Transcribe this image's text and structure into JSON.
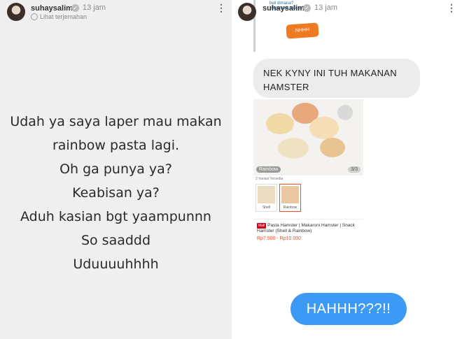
{
  "left_story": {
    "username": "suhaysalim",
    "time": "13 jam",
    "translate_label": "Lihat terjemahan",
    "lines": [
      "Udah ya saya laper mau makan",
      "rainbow pasta lagi.",
      "Oh ga punya ya?",
      "Keabisan ya?",
      "Aduh kasian bgt yaampunnn",
      "So saaddd",
      "Uduuuuhhhh"
    ]
  },
  "right_story": {
    "username": "suhaysalim",
    "time": "13 jam",
    "quoted_text": "beli dimana? Hagemaik beli ya? ...",
    "sticker_text": "NHHH",
    "message_grey": "NEK KYNY INI TUH MAKANAN HAMSTER",
    "product": {
      "image_badge": "Rainbow",
      "image_counter": "3/3",
      "variations_title": "2 Variasi Tersedia",
      "variations": [
        "Shell",
        "Rainbow"
      ],
      "mall_tag": "Mall",
      "title": "Pasta Hamster | Makaroni Hamster | Snack Hamster (Shell & Rainbow)",
      "price": "Rp7.500 - Rp10.000"
    },
    "message_blue": "HAHHH???!!"
  },
  "colors": {
    "left_bg": "#efefef",
    "blue_bubble": "#3d9af4",
    "grey_bubble": "#ececec",
    "price": "#ee4d2d",
    "sticker": "#f07a22"
  },
  "icons": {
    "verified": "verified-badge-icon",
    "more": "more-vertical-icon",
    "translate": "globe-icon"
  }
}
